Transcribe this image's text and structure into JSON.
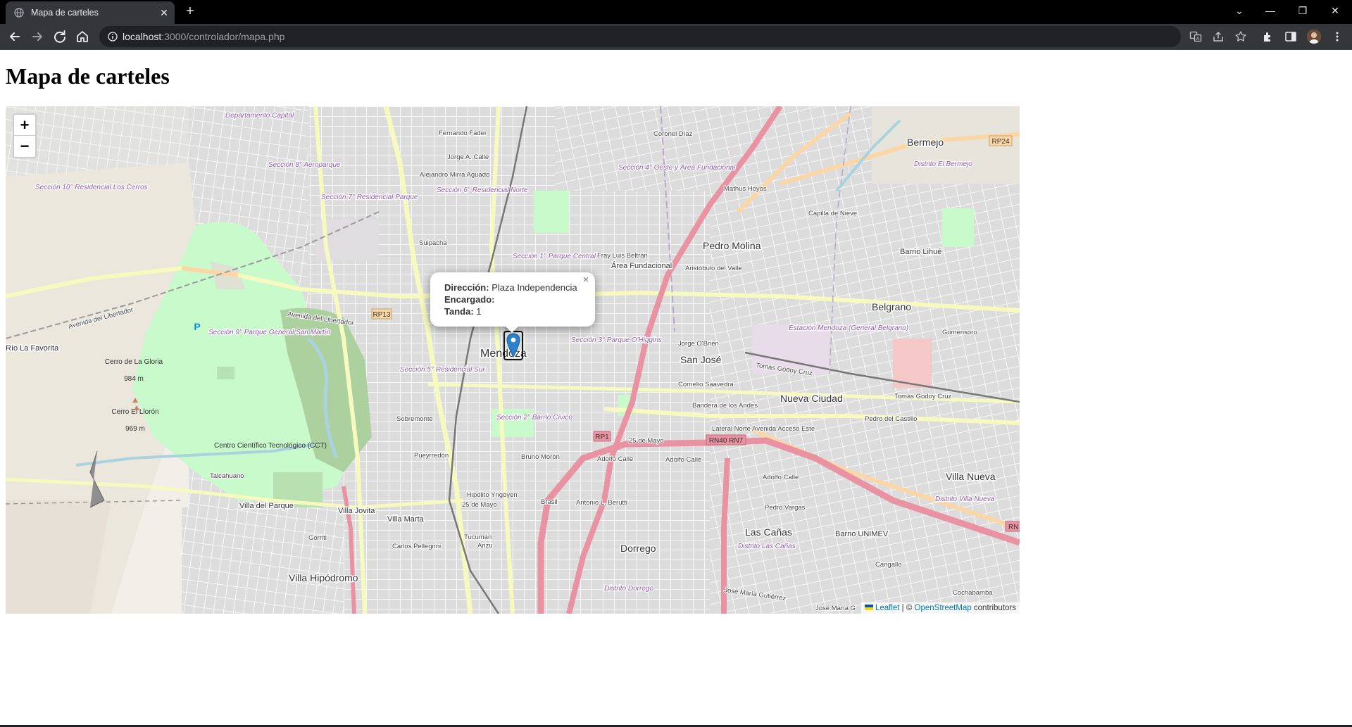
{
  "browser": {
    "tab_title": "Mapa de carteles",
    "new_tab_symbol": "+",
    "url_host": "localhost",
    "url_rest": ":3000/controlador/mapa.php",
    "icons": [
      "back-icon",
      "forward-icon",
      "reload-icon",
      "home-icon",
      "info-icon",
      "translate-icon",
      "share-icon",
      "star-icon",
      "extensions-icon",
      "side-panel-icon",
      "profile-avatar",
      "menu-icon"
    ]
  },
  "page": {
    "title": "Mapa de carteles"
  },
  "map": {
    "zoom_in": "+",
    "zoom_out": "−",
    "popup": {
      "direccion_label": "Dirección:",
      "direccion_value": "Plaza Independencia",
      "encargado_label": "Encargado:",
      "encargado_value": "",
      "tanda_label": "Tanda:",
      "tanda_value": "1",
      "close": "×"
    },
    "attribution": {
      "leaflet": "Leaflet",
      "separator": " | © ",
      "osm": "OpenStreetMap",
      "suffix": " contributors"
    },
    "labels": {
      "city": "Mendoza",
      "pedro_molina": "Pedro Molina",
      "belgrano": "Belgrano",
      "san_jose": "San José",
      "nueva_ciudad": "Nueva Ciudad",
      "villa_nueva": "Villa Nueva",
      "dorrego": "Dorrego",
      "las_canas": "Las Cañas",
      "villa_hipodromo": "Villa Hipódromo",
      "bermejo": "Bermejo",
      "area_fundacional": "Área Fundacional",
      "barrio_unimev": "Barrio UNIMEV",
      "barrio_lihue": "Barrio Lihué",
      "villa_jovita": "Villa Jovita",
      "villa_marta": "Villa Marta",
      "villa_del_parque": "Villa del Parque",
      "cerro_gloria": "Cerro de La Gloria",
      "cerro_gloria_alt": "984 m",
      "cerro_llorón": "Cerro El Llorón",
      "cerro_llorón_alt": "969 m",
      "seccion_1": "Sección 1° Parque Central",
      "seccion_2": "Sección 2° Barrio Cívico",
      "seccion_3": "Sección 3° Parque O'Higgins",
      "seccion_4": "Sección 4° Oeste y Área Fundacional",
      "seccion_5": "Sección 5° Residencial Sur",
      "seccion_6": "Sección 6° Residencial Norte",
      "seccion_7": "Sección 7° Residencial Parque",
      "seccion_8": "Sección 8° Aeroparque",
      "seccion_9": "Sección 9° Parque General San Martín",
      "seccion_10": "Sección 10° Residencial Los Cerros",
      "departamento_capital": "Departamento Capital",
      "av_libertador": "Avenida del Libertador",
      "rp13": "RP13",
      "rp1": "RP1",
      "rp24": "RP24",
      "rn40": "RN40 RN7",
      "acceso_este": "Lateral Norte Avenida Acceso Este",
      "bandera_andes": "Bandera de los Andes",
      "godoy_cruz": "Tomás Godoy Cruz",
      "coronel_diaz": "Coronel Díaz",
      "fernando_fader": "Fernando Fader",
      "mathus_hoyos": "Mathus Hoyos",
      "capilla_nieve": "Capilla de Nieve",
      "adolfo_calle": "Adolfo Calle",
      "veinticinco_mayo": "25 de Mayo",
      "sobremonte": "Sobremonte",
      "talcahuano": "Talcahuano",
      "pueyrredon": "Pueyrredón",
      "gomensoro": "Gomensoro",
      "estacion": "Estación Mendoza (General Belgrano)",
      "distrito_bermejo": "Distrito El Bermejo",
      "distrito_dorrego": "Distrito Dorrego",
      "distrito_villa_nueva": "Distrito Villa Nueva",
      "distrito_las_canas": "Distrito Las Cañas",
      "cct": "Centro Científico Tecnológico (CCT)",
      "rio_la_favorita": "Río La Favorita",
      "parking": "P",
      "jose_maria_gutierrez": "José María Gutiérrez",
      "jose_maria_g": "José María G",
      "cochabamba": "Cochabamba",
      "cangallo": "Cangallo",
      "pedro_vargas": "Pedro Vargas",
      "brasil": "Brasil",
      "antonio_berutti": "Antonio L. Berutti",
      "jorge_obrien": "Jorge O'Brien",
      "cornelio_saavedra": "Cornelio Saavedra",
      "fray_luis_beltran": "Fray Luis Beltrán",
      "aristobulo": "Aristóbulo del Valle",
      "suipacha": "Suipacha",
      "jorge_calle": "Jorge A. Calle",
      "alejandro_aguado": "Alejandro Mirra Aguado",
      "hipolito_yrigoyen": "Hipólito Yrigoyen",
      "tucuman": "Tucumán",
      "arizu": "Arizu",
      "gorriti": "Gorriti",
      "carlos_pellegrini": "Carlos Pellegrini",
      "bruno_moron": "Bruno Morón",
      "pedro_castillo": "Pedro del Castillo",
      "rn_edge": "RN"
    }
  }
}
